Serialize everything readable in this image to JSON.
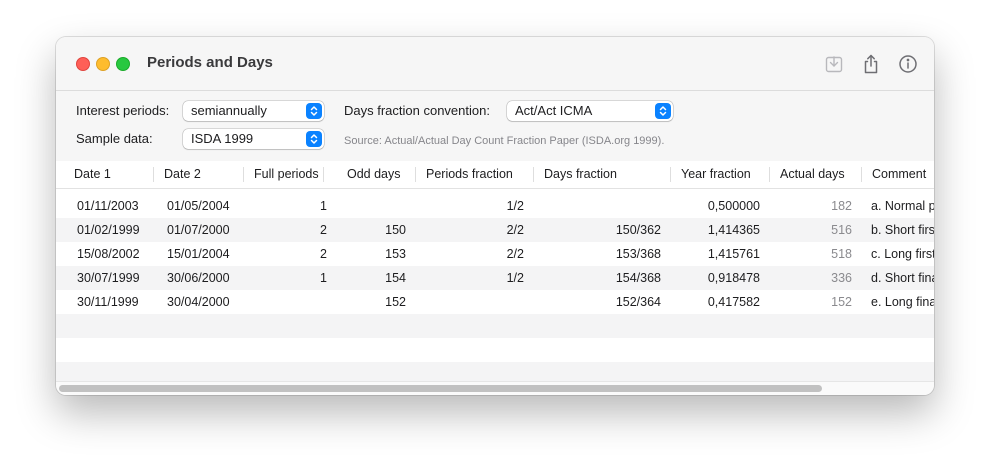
{
  "window": {
    "title": "Periods and Days"
  },
  "controls": {
    "interest_periods_label": "Interest periods:",
    "interest_periods_value": "semiannually",
    "days_fraction_label": "Days fraction convention:",
    "days_fraction_value": "Act/Act ICMA",
    "sample_data_label": "Sample data:",
    "sample_data_value": "ISDA 1999",
    "source_text": "Source: Actual/Actual Day Count Fraction Paper (ISDA.org 1999)."
  },
  "toolbar_icons": [
    "download-icon",
    "share-icon",
    "info-icon"
  ],
  "table": {
    "columns": [
      "Date 1",
      "Date 2",
      "Full periods",
      "Odd days",
      "Periods fraction",
      "Days fraction",
      "Year fraction",
      "Actual days",
      "Comment"
    ],
    "rows": [
      {
        "date1": "01/11/2003",
        "date2": "01/05/2004",
        "full": "1",
        "odd": "",
        "pfrac": "1/2",
        "dfrac": "",
        "yfrac": "0,500000",
        "actual": "182",
        "comment": "a. Normal p"
      },
      {
        "date1": "01/02/1999",
        "date2": "01/07/2000",
        "full": "2",
        "odd": "150",
        "pfrac": "2/2",
        "dfrac": "150/362",
        "yfrac": "1,414365",
        "actual": "516",
        "comment": "b. Short firs"
      },
      {
        "date1": "15/08/2002",
        "date2": "15/01/2004",
        "full": "2",
        "odd": "153",
        "pfrac": "2/2",
        "dfrac": "153/368",
        "yfrac": "1,415761",
        "actual": "518",
        "comment": "c. Long first"
      },
      {
        "date1": "30/07/1999",
        "date2": "30/06/2000",
        "full": "1",
        "odd": "154",
        "pfrac": "1/2",
        "dfrac": "154/368",
        "yfrac": "0,918478",
        "actual": "336",
        "comment": "d. Short fina"
      },
      {
        "date1": "30/11/1999",
        "date2": "30/04/2000",
        "full": "",
        "odd": "152",
        "pfrac": "",
        "dfrac": "152/364",
        "yfrac": "0,417582",
        "actual": "152",
        "comment": "e. Long fina"
      }
    ]
  },
  "colors": {
    "accent": "#0a82ff",
    "close": "#fe5f57",
    "minimize": "#febc2e",
    "maximize": "#28c840"
  }
}
